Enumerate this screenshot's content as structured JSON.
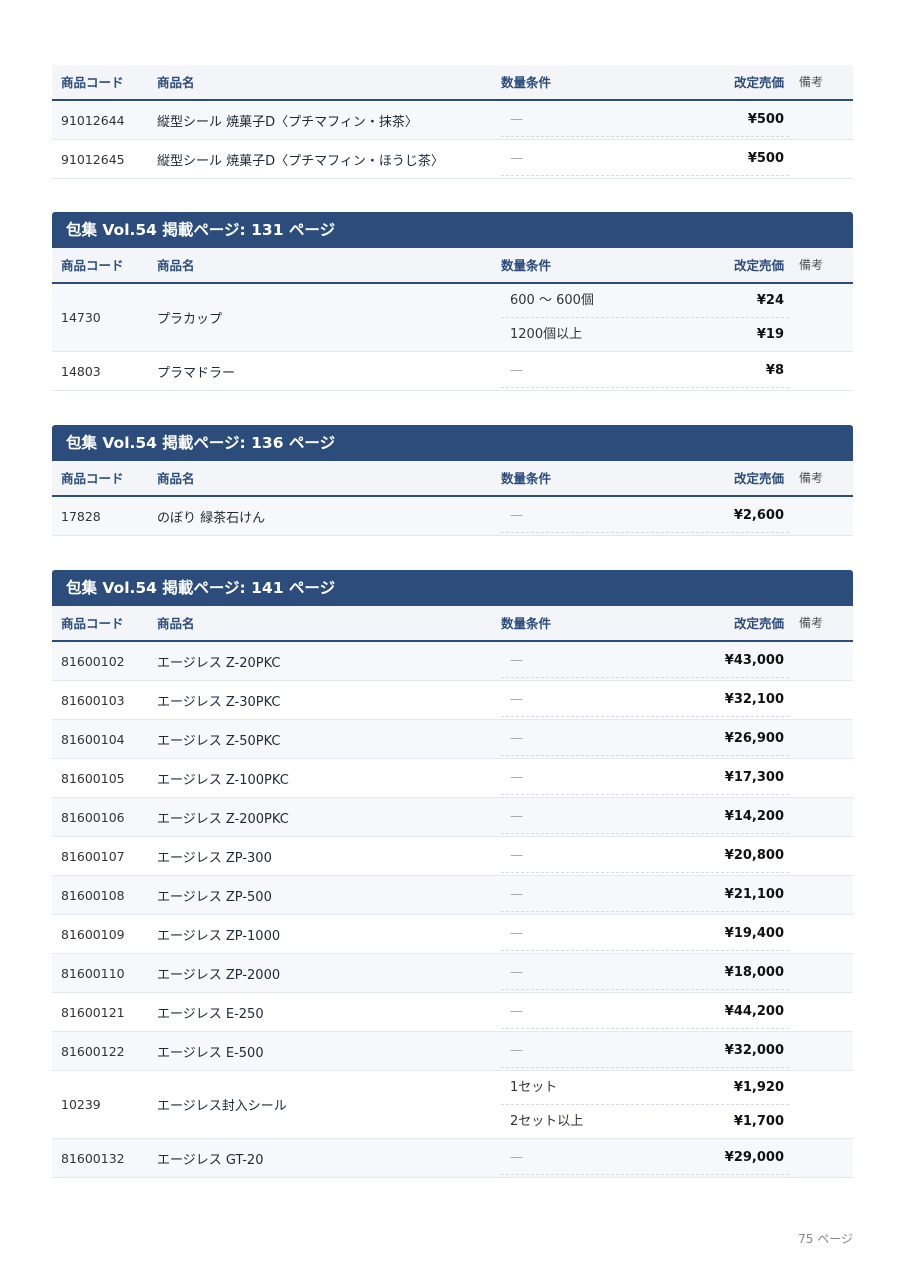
{
  "headers": {
    "code": "商品コード",
    "name": "商品名",
    "qty": "数量条件",
    "price": "改定売価",
    "note": "備考"
  },
  "dash": "—",
  "sections": [
    {
      "title": "",
      "rows": [
        {
          "code": "91012644",
          "name": "縦型シール 焼菓子D〈プチマフィン・抹茶〉",
          "tiers": [
            {
              "qty": "—",
              "price": "¥500"
            }
          ]
        },
        {
          "code": "91012645",
          "name": "縦型シール 焼菓子D〈プチマフィン・ほうじ茶〉",
          "tiers": [
            {
              "qty": "—",
              "price": "¥500"
            }
          ]
        }
      ]
    },
    {
      "title": "包集 Vol.54 掲載ページ: 131 ページ",
      "rows": [
        {
          "code": "14730",
          "name": "プラカップ",
          "tiers": [
            {
              "qty": "600 〜 600個",
              "price": "¥24"
            },
            {
              "qty": "1200個以上",
              "price": "¥19"
            }
          ]
        },
        {
          "code": "14803",
          "name": "プラマドラー",
          "tiers": [
            {
              "qty": "—",
              "price": "¥8"
            }
          ]
        }
      ]
    },
    {
      "title": "包集 Vol.54 掲載ページ: 136 ページ",
      "rows": [
        {
          "code": "17828",
          "name": "のぼり 緑茶石けん",
          "tiers": [
            {
              "qty": "—",
              "price": "¥2,600"
            }
          ]
        }
      ]
    },
    {
      "title": "包集 Vol.54 掲載ページ: 141 ページ",
      "rows": [
        {
          "code": "81600102",
          "name": "エージレス Z-20PKC",
          "tiers": [
            {
              "qty": "—",
              "price": "¥43,000"
            }
          ]
        },
        {
          "code": "81600103",
          "name": "エージレス Z-30PKC",
          "tiers": [
            {
              "qty": "—",
              "price": "¥32,100"
            }
          ]
        },
        {
          "code": "81600104",
          "name": "エージレス Z-50PKC",
          "tiers": [
            {
              "qty": "—",
              "price": "¥26,900"
            }
          ]
        },
        {
          "code": "81600105",
          "name": "エージレス Z-100PKC",
          "tiers": [
            {
              "qty": "—",
              "price": "¥17,300"
            }
          ]
        },
        {
          "code": "81600106",
          "name": "エージレス Z-200PKC",
          "tiers": [
            {
              "qty": "—",
              "price": "¥14,200"
            }
          ]
        },
        {
          "code": "81600107",
          "name": "エージレス ZP-300",
          "tiers": [
            {
              "qty": "—",
              "price": "¥20,800"
            }
          ]
        },
        {
          "code": "81600108",
          "name": "エージレス ZP-500",
          "tiers": [
            {
              "qty": "—",
              "price": "¥21,100"
            }
          ]
        },
        {
          "code": "81600109",
          "name": "エージレス ZP-1000",
          "tiers": [
            {
              "qty": "—",
              "price": "¥19,400"
            }
          ]
        },
        {
          "code": "81600110",
          "name": "エージレス ZP-2000",
          "tiers": [
            {
              "qty": "—",
              "price": "¥18,000"
            }
          ]
        },
        {
          "code": "81600121",
          "name": "エージレス E-250",
          "tiers": [
            {
              "qty": "—",
              "price": "¥44,200"
            }
          ]
        },
        {
          "code": "81600122",
          "name": "エージレス E-500",
          "tiers": [
            {
              "qty": "—",
              "price": "¥32,000"
            }
          ]
        },
        {
          "code": "10239",
          "name": "エージレス封入シール",
          "tiers": [
            {
              "qty": "1セット",
              "price": "¥1,920"
            },
            {
              "qty": "2セット以上",
              "price": "¥1,700"
            }
          ]
        },
        {
          "code": "81600132",
          "name": "エージレス GT-20",
          "tiers": [
            {
              "qty": "—",
              "price": "¥29,000"
            }
          ]
        }
      ]
    }
  ],
  "footer": {
    "page_number": "75 ページ"
  }
}
